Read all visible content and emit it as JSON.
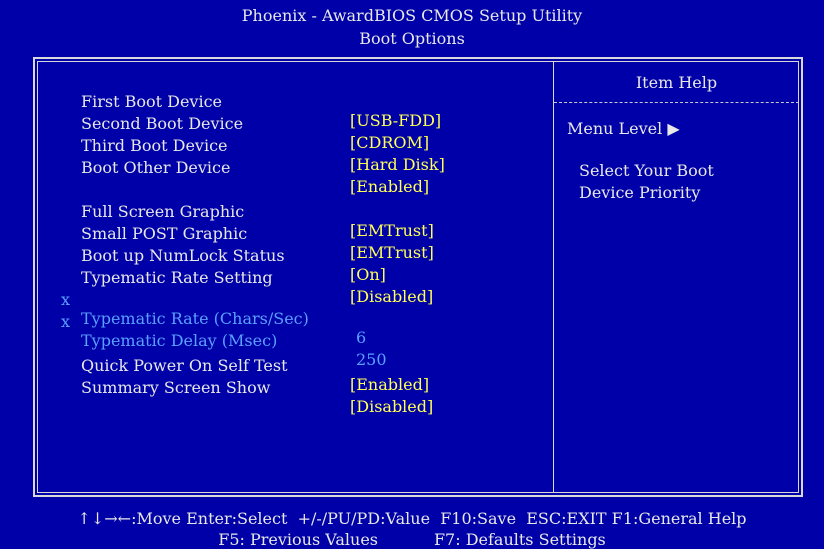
{
  "header": {
    "title": "Phoenix - AwardBIOS CMOS Setup Utility",
    "subtitle": "Boot Options"
  },
  "settings": [
    {
      "label": "First Boot Device",
      "value": "[USB-FDD]",
      "enabled": true
    },
    {
      "label": "Second Boot Device",
      "value": "[CDROM]",
      "enabled": true
    },
    {
      "label": "Third Boot Device",
      "value": "[Hard Disk]",
      "enabled": true
    },
    {
      "label": "Boot Other Device",
      "value": "[Enabled]",
      "enabled": true
    },
    {
      "label": "Full Screen Graphic",
      "value": "[EMTrust]",
      "enabled": true
    },
    {
      "label": "Small POST Graphic",
      "value": "[EMTrust]",
      "enabled": true
    },
    {
      "label": "Boot up NumLock Status",
      "value": "[On]",
      "enabled": true
    },
    {
      "label": "Typematic Rate Setting",
      "value": "[Disabled]",
      "enabled": true
    },
    {
      "prefix": "x",
      "label": "Typematic Rate (Chars/Sec)",
      "value": "6",
      "enabled": false
    },
    {
      "prefix": "x",
      "label": "Typematic Delay (Msec)",
      "value": "250",
      "enabled": false
    },
    {
      "label": "Quick Power On Self Test",
      "value": "[Enabled]",
      "enabled": true
    },
    {
      "label": "Summary Screen Show",
      "value": "[Disabled]",
      "enabled": true
    }
  ],
  "help": {
    "title": "Item Help",
    "menu_level": "Menu Level ▶",
    "line1": "Select Your Boot",
    "line2": "Device Priority"
  },
  "footer": {
    "line1": "↑↓→←:Move Enter:Select  +/-/PU/PD:Value  F10:Save  ESC:EXIT F1:General Help",
    "line2": "F5: Previous Values           F7: Defaults Settings"
  },
  "colors": {
    "background": "#0000a8",
    "text": "#e8e8e8",
    "value": "#ffff54",
    "disabled": "#5aa0ff"
  }
}
